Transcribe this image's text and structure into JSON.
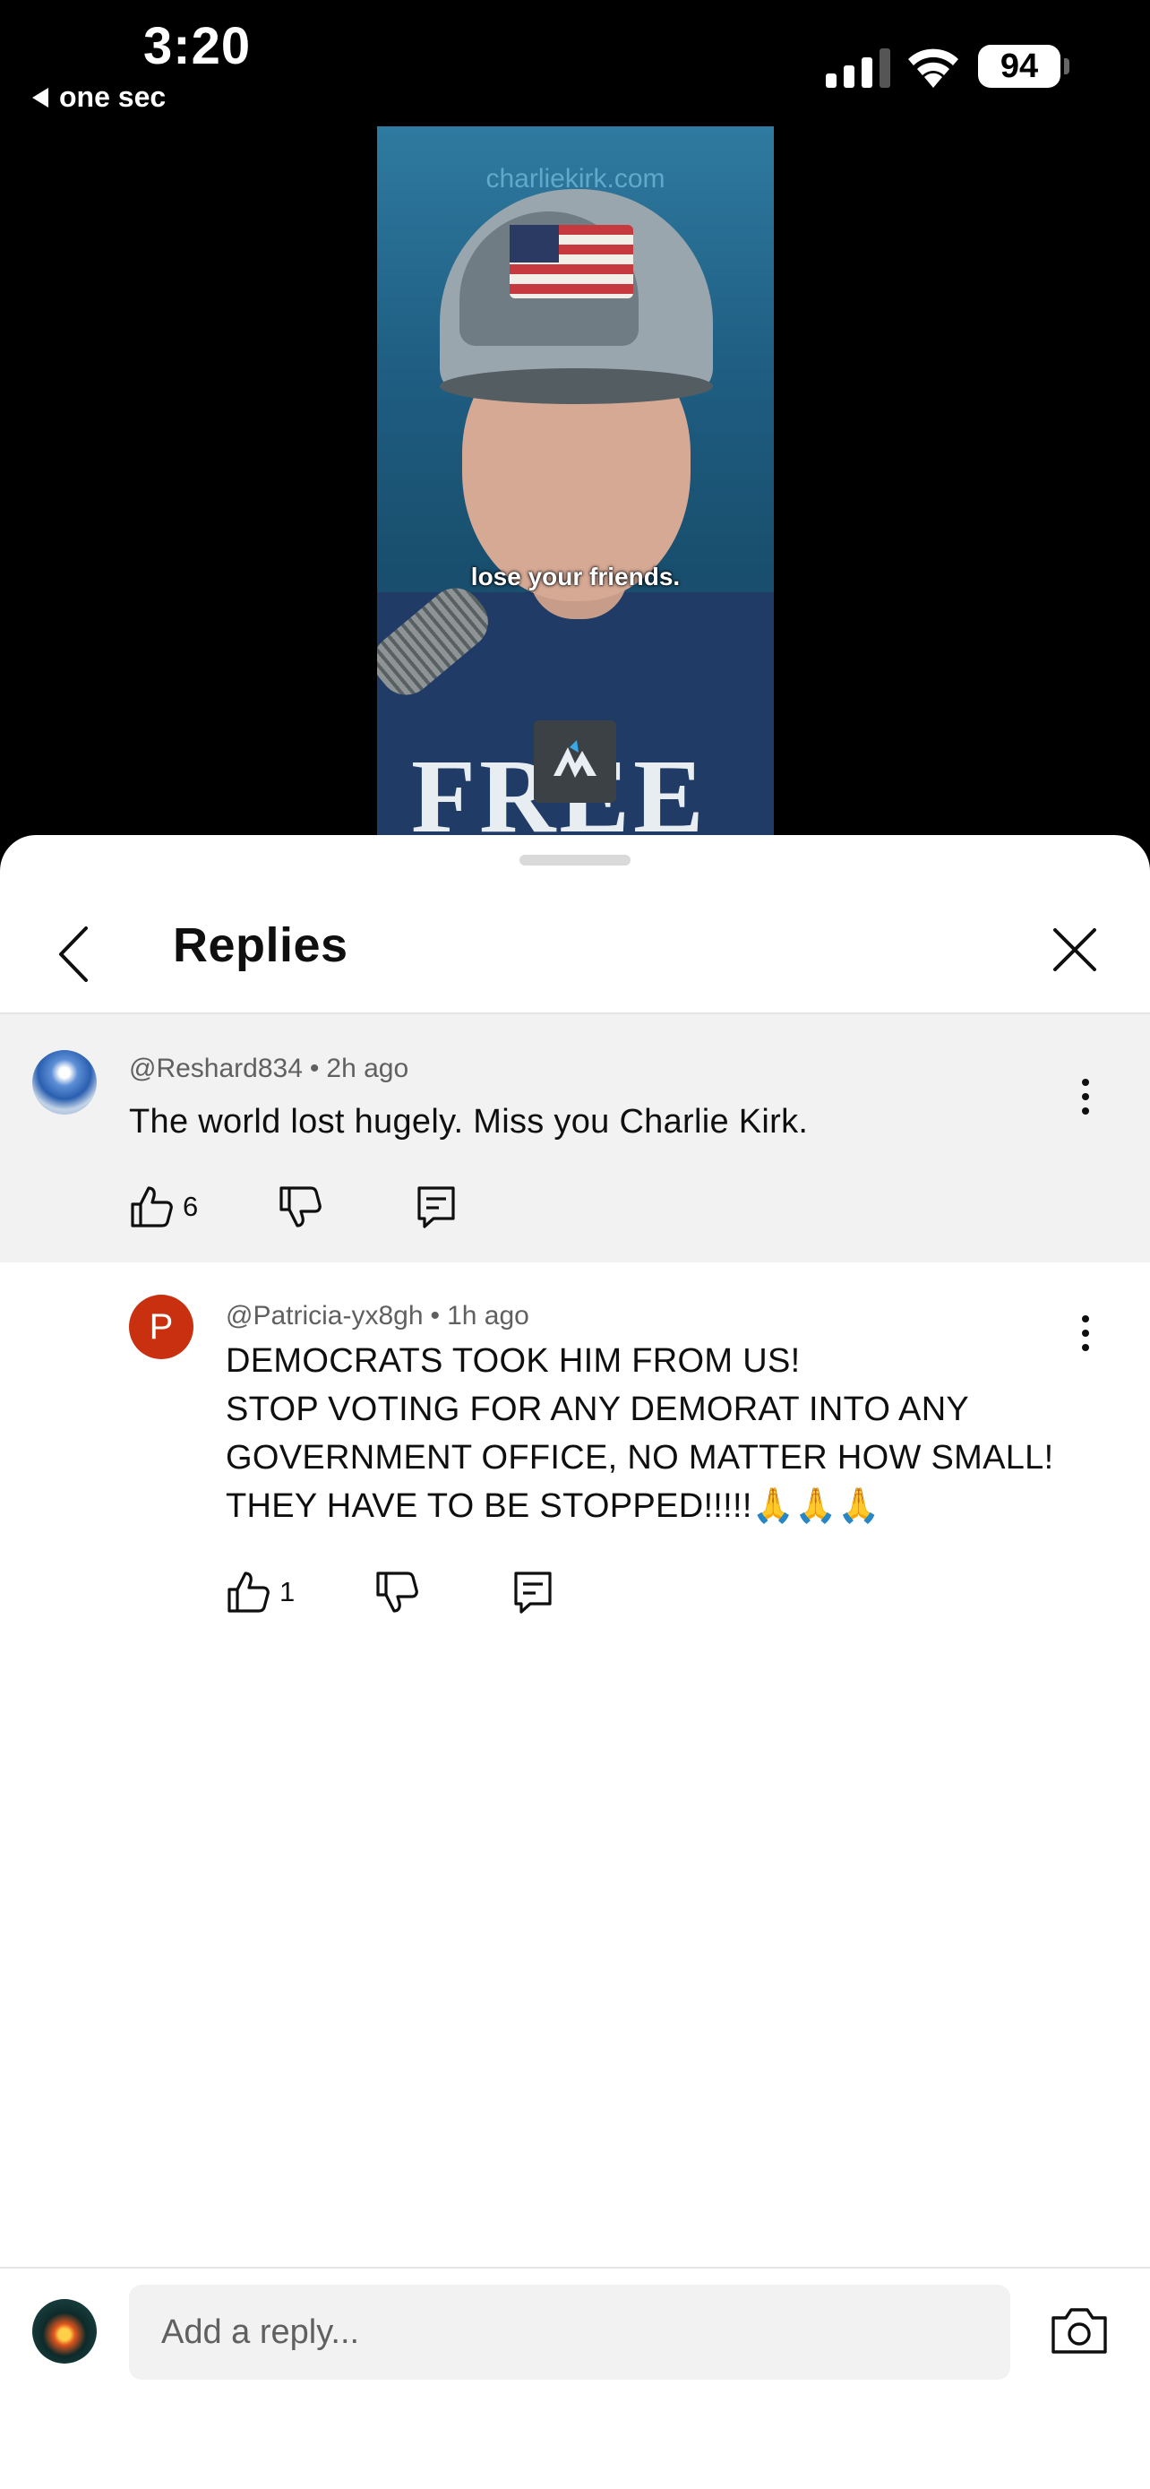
{
  "status_bar": {
    "time": "3:20",
    "back_app_label": "one sec",
    "battery": "94"
  },
  "video": {
    "watermark": "charliekirk.com",
    "caption": "lose your friends.",
    "shirt_text": "FREE"
  },
  "sheet": {
    "title": "Replies"
  },
  "parent_comment": {
    "author": "@Reshard834",
    "time": "2h ago",
    "text": "The world lost hugely. Miss you Charlie Kirk.",
    "likes": "6"
  },
  "reply_comment": {
    "avatar_letter": "P",
    "author": "@Patricia-yx8gh",
    "time": "1h ago",
    "lines": [
      "DEMOCRATS TOOK HIM FROM US!",
      "STOP VOTING FOR ANY DEMORAT INTO ANY",
      "GOVERNMENT OFFICE, NO MATTER HOW SMALL!",
      "THEY HAVE TO BE STOPPED!!!!!🙏🙏🙏"
    ],
    "likes": "1",
    "avatar_color": "#c9300f"
  },
  "footer": {
    "reply_placeholder": "Add a reply..."
  },
  "icons": {
    "back": "chevron-left-icon",
    "close": "close-icon",
    "like": "thumbs-up-icon",
    "dislike": "thumbs-down-icon",
    "reply": "comment-icon",
    "more": "more-vertical-icon",
    "camera": "camera-icon"
  }
}
